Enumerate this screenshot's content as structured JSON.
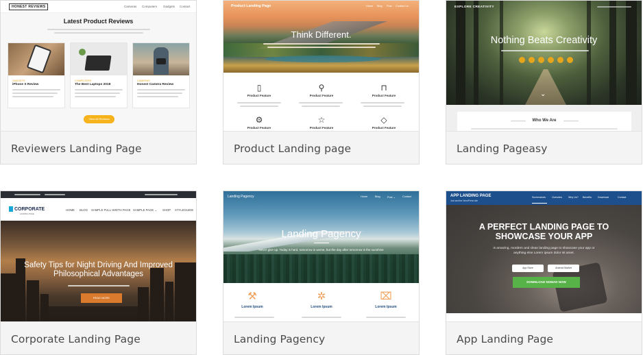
{
  "cards": [
    {
      "caption": "Reviewers Landing Page",
      "preview": {
        "logo": "HONEST REVIEWS",
        "menu": [
          "Cameras",
          "Computers",
          "Gadgets",
          "Contact"
        ],
        "heading": "Latest Product Reviews",
        "posts": [
          {
            "category": "GADGETS",
            "title": "iPhone X Review"
          },
          {
            "category": "COMPUTERS",
            "title": "The Best Laptops 2018"
          },
          {
            "category": "CAMERAS",
            "title": "Honest Camera Review"
          }
        ],
        "button": "View All Reviews",
        "accent": "#f6b31b"
      }
    },
    {
      "caption": "Product Landing page",
      "preview": {
        "brand": "Product Landing Page",
        "menu": [
          "Home",
          "Blog",
          "Post",
          "Contact Us"
        ],
        "heading": "Think Different.",
        "feature_label": "Product Feature",
        "feature_icons": [
          "phone-icon",
          "search-icon",
          "bookmark-icon",
          "gear-icon",
          "star-icon",
          "diamond-icon"
        ]
      }
    },
    {
      "caption": "Landing Pageasy",
      "preview": {
        "brand": "EXPLORE CREATIVITY",
        "heading": "Nothing Beats Creativity",
        "section_title": "Who We Are",
        "accent": "#e7a51c"
      }
    },
    {
      "caption": "Corporate Landing Page",
      "preview": {
        "logo": "CORPORATE",
        "logo_sub": "LANDING PAGE",
        "menu": [
          "HOME",
          "BLOG",
          "SAMPLE FULL-WIDTH PAGE",
          "SAMPLE PAGE ⌄",
          "SHOP",
          "STYLEGUIDE"
        ],
        "heading_line1": "Safety Tips for Night Driving And Improved",
        "heading_line2": "Philosophical Advantages",
        "button": "READ MORE",
        "accent": "#d97a2c"
      }
    },
    {
      "caption": "Landing Pagency",
      "preview": {
        "brand": "Landing Pagency",
        "menu": [
          "Home",
          "Blog",
          "Post ⌄",
          "Contact"
        ],
        "heading": "Landing Pagency",
        "subheading": "Never give up. Today is hard, tomorrow is worse, but the day after tomorrow is the sunshine",
        "feature_label": "Lorem Ipsum",
        "feature_icons": [
          "paint-roller-icon",
          "gear-icon",
          "chart-icon"
        ],
        "accent": "#f0a05a"
      }
    },
    {
      "caption": "App Landing Page",
      "preview": {
        "brand": "APP LANDING PAGE",
        "tagline": "Just another WordPress site",
        "menu": [
          "Screenshots",
          "Overview",
          "Why Us?",
          "Benefits",
          "Download",
          "Contact"
        ],
        "heading_line1": "A PERFECT LANDING PAGE TO",
        "heading_line2": "SHOWCASE YOUR APP",
        "subheading_line1": "is amazing, mordern and clean landing page to showcase your app or",
        "subheading_line2": "anything else Lorem ipsum dolor sit amet.",
        "store1": "App Store",
        "store2": "Android Market",
        "button": "DOWNLOAD NOMAD NOW",
        "accent": "#57b347",
        "brand_color": "#1d4f8c"
      }
    }
  ]
}
